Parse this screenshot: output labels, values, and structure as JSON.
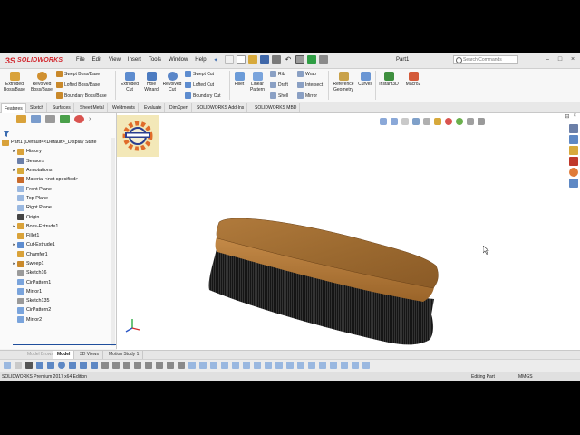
{
  "app": {
    "name": "SOLIDWORKS",
    "logo_mark": "3S"
  },
  "menu": [
    "File",
    "Edit",
    "View",
    "Insert",
    "Tools",
    "Window",
    "Help"
  ],
  "document": {
    "name": "Part1"
  },
  "search": {
    "placeholder": "Search Commands"
  },
  "ribbon": {
    "extruded_boss": "Extruded Boss/Base",
    "revolved_boss": "Revolved Boss/Base",
    "swept_boss": "Swept Boss/Base",
    "lofted_boss": "Lofted Boss/Base",
    "boundary_boss": "Boundary Boss/Base",
    "extruded_cut": "Extruded Cut",
    "hole_wizard": "Hole Wizard",
    "revolved_cut": "Revolved Cut",
    "swept_cut": "Swept Cut",
    "lofted_cut": "Lofted Cut",
    "boundary_cut": "Boundary Cut",
    "fillet": "Fillet",
    "linear_pattern": "Linear Pattern",
    "rib": "Rib",
    "draft": "Draft",
    "shell": "Shell",
    "wrap": "Wrap",
    "intersect": "Intersect",
    "mirror": "Mirror",
    "reference_geometry": "Reference Geometry",
    "curves": "Curves",
    "instant3d": "Instant3D",
    "macro": "Macro2"
  },
  "command_tabs": [
    "Features",
    "Sketch",
    "Surfaces",
    "Sheet Metal",
    "Weldments",
    "Evaluate",
    "DimXpert",
    "SOLIDWORKS Add-Ins",
    "SOLIDWORKS MBD"
  ],
  "tree": {
    "root": "Part1  (Default<<Default>_Display State",
    "items": [
      {
        "label": "History",
        "arrow": "▸"
      },
      {
        "label": "Sensors",
        "arrow": ""
      },
      {
        "label": "Annotations",
        "arrow": "▸"
      },
      {
        "label": "Material <not specified>",
        "arrow": ""
      },
      {
        "label": "Front Plane",
        "arrow": ""
      },
      {
        "label": "Top Plane",
        "arrow": ""
      },
      {
        "label": "Right Plane",
        "arrow": ""
      },
      {
        "label": "Origin",
        "arrow": ""
      },
      {
        "label": "Boss-Extrude1",
        "arrow": "▸"
      },
      {
        "label": "Fillet1",
        "arrow": ""
      },
      {
        "label": "Cut-Extrude1",
        "arrow": "▸"
      },
      {
        "label": "Chamfer1",
        "arrow": ""
      },
      {
        "label": "Sweep1",
        "arrow": "▸"
      },
      {
        "label": "Sketch16",
        "arrow": ""
      },
      {
        "label": "CirPattern1",
        "arrow": ""
      },
      {
        "label": "Mirror1",
        "arrow": ""
      },
      {
        "label": "Sketch135",
        "arrow": ""
      },
      {
        "label": "CirPattern2",
        "arrow": ""
      },
      {
        "label": "Mirror2",
        "arrow": ""
      }
    ]
  },
  "bottom_tabs": [
    "Model",
    "3D Views",
    "Motion Study 1"
  ],
  "bottom_tabs_dim": "Model Browser",
  "status": {
    "left": "SOLIDWORKS Premium 2017 x64 Edition",
    "mode": "Editing Part",
    "units": "MMGS"
  },
  "colors": {
    "brand": "#d2232a",
    "wood": "#a0692f",
    "bristle": "#1a1a1a",
    "selection": "#1f4e9c"
  }
}
